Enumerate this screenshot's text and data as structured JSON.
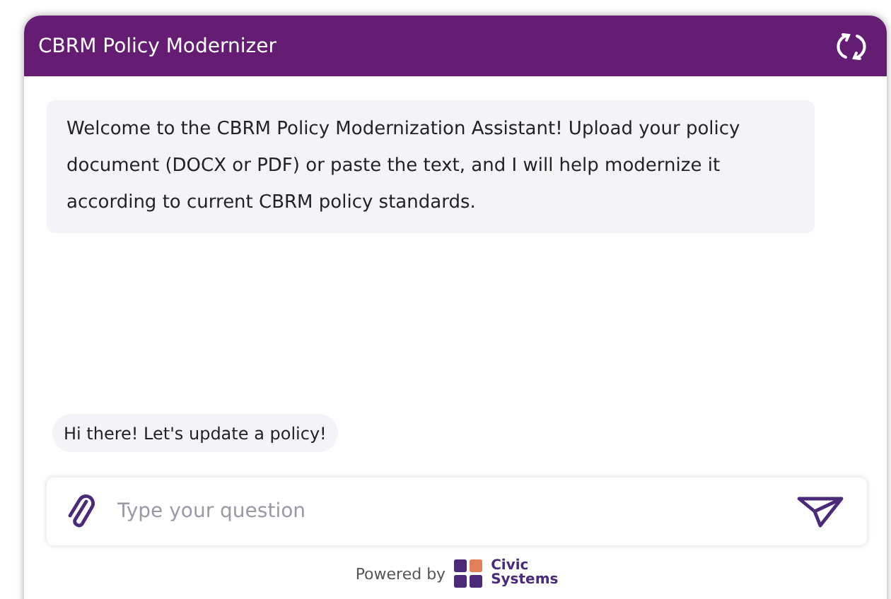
{
  "header": {
    "title": "CBRM Policy Modernizer"
  },
  "messages": [
    {
      "text": "Welcome to the CBRM Policy Modernization Assistant! Upload your policy document (DOCX or PDF) or paste the text, and I will help modernize it according to current CBRM policy standards."
    }
  ],
  "suggestions": [
    "Hi there! Let's update a policy!"
  ],
  "input": {
    "placeholder": "Type your question"
  },
  "footer": {
    "powered_by": "Powered by",
    "logo_line_1": "Civic",
    "logo_line_2": "Systems"
  }
}
